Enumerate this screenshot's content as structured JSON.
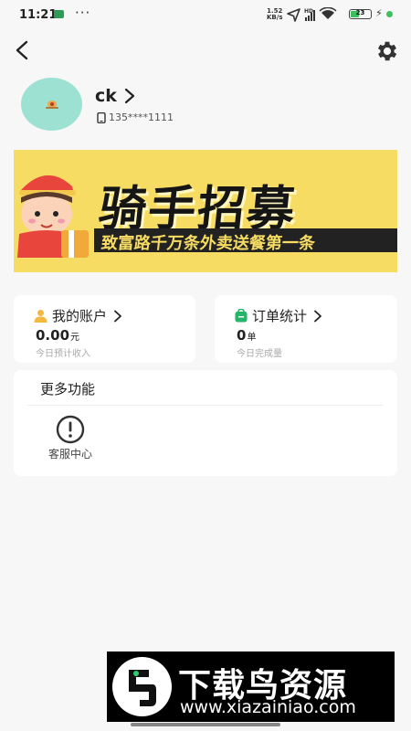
{
  "status_bar": {
    "time": "11:21",
    "dots": "···",
    "net_speed_value": "1.52",
    "net_speed_unit": "KB/s",
    "signal_tag": "HD",
    "battery_level": "23"
  },
  "profile": {
    "username": "ck",
    "phone": "135****1111"
  },
  "banner": {
    "title": "骑手招募",
    "subtitle": "致富路千万条外卖送餐第一条"
  },
  "account_card": {
    "title": "我的账户",
    "value": "0.00",
    "unit": "元",
    "note": "今日预计收入"
  },
  "orders_card": {
    "title": "订单统计",
    "value": "0",
    "unit": "单",
    "note": "今日完成量"
  },
  "more_section": {
    "title": "更多功能",
    "items": [
      {
        "label": "客服中心",
        "icon": "alert-circle-icon"
      }
    ]
  },
  "watermark": {
    "main": "下载鸟资源",
    "url": "www.xiazainiao.com"
  },
  "colors": {
    "avatar_bg": "#9de1d3",
    "banner_bg": "#f6dc63",
    "account_icon": "#f5b940",
    "orders_icon": "#26b36a"
  }
}
